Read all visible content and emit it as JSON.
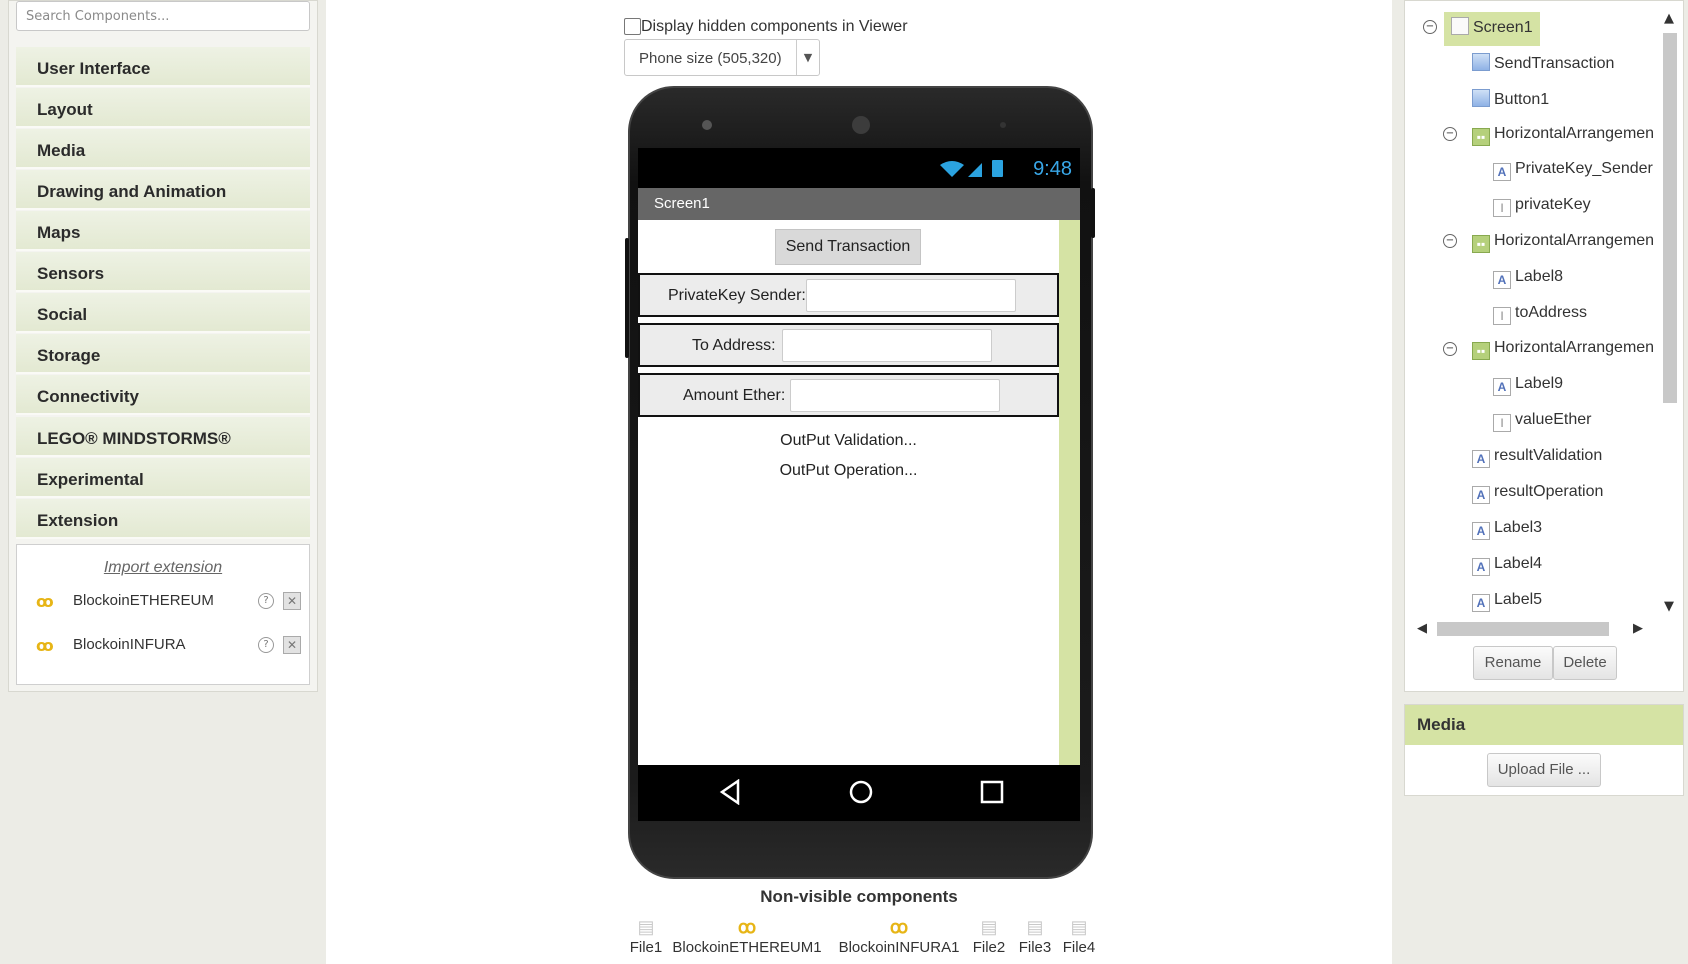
{
  "palette": {
    "search_placeholder": "Search Components...",
    "categories": [
      "User Interface",
      "Layout",
      "Media",
      "Drawing and Animation",
      "Maps",
      "Sensors",
      "Social",
      "Storage",
      "Connectivity",
      "LEGO® MINDSTORMS®",
      "Experimental",
      "Extension"
    ],
    "import_extension": "Import extension",
    "extensions": [
      {
        "name": "BlockoinETHEREUM",
        "icon": "blockoin-icon"
      },
      {
        "name": "BlockoinINFURA",
        "icon": "blockoin-icon"
      }
    ],
    "help_glyph": "?",
    "delete_glyph": "✕"
  },
  "viewer": {
    "hidden_label": "Display hidden components in Viewer",
    "size_value": "Phone size (505,320)",
    "status_time": "9:48",
    "screen_title": "Screen1",
    "send_button": "Send Transaction",
    "rows": [
      {
        "label": "PrivateKey Sender:"
      },
      {
        "label": "To Address:"
      },
      {
        "label": "Amount Ether:"
      }
    ],
    "output_validation": "OutPut Validation...",
    "output_operation": "OutPut Operation...",
    "non_visible_title": "Non-visible components",
    "non_visible": [
      {
        "name": "File1",
        "icon": "file-icon"
      },
      {
        "name": "BlockoinETHEREUM1",
        "icon": "blockoin-icon"
      },
      {
        "name": "BlockoinINFURA1",
        "icon": "blockoin-icon"
      },
      {
        "name": "File2",
        "icon": "file-icon"
      },
      {
        "name": "File3",
        "icon": "file-icon"
      },
      {
        "name": "File4",
        "icon": "file-icon"
      }
    ]
  },
  "tree": {
    "items": [
      {
        "name": "Screen1",
        "type": "screen"
      },
      {
        "name": "SendTransaction",
        "type": "button"
      },
      {
        "name": "Button1",
        "type": "button"
      },
      {
        "name": "HorizontalArrangemen",
        "type": "arrangement"
      },
      {
        "name": "PrivateKey_Sender",
        "type": "label"
      },
      {
        "name": "privateKey",
        "type": "textbox"
      },
      {
        "name": "HorizontalArrangemen",
        "type": "arrangement"
      },
      {
        "name": "Label8",
        "type": "label"
      },
      {
        "name": "toAddress",
        "type": "textbox"
      },
      {
        "name": "HorizontalArrangemen",
        "type": "arrangement"
      },
      {
        "name": "Label9",
        "type": "label"
      },
      {
        "name": "valueEther",
        "type": "textbox"
      },
      {
        "name": "resultValidation",
        "type": "label"
      },
      {
        "name": "resultOperation",
        "type": "label"
      },
      {
        "name": "Label3",
        "type": "label"
      },
      {
        "name": "Label4",
        "type": "label"
      },
      {
        "name": "Label5",
        "type": "label"
      }
    ],
    "rename": "Rename",
    "delete": "Delete"
  },
  "media": {
    "title": "Media",
    "upload": "Upload File ..."
  },
  "colors": {
    "accent_green": "#d5e3a4",
    "status_blue": "#39a7e8",
    "extension_gold": "#e7b516"
  }
}
